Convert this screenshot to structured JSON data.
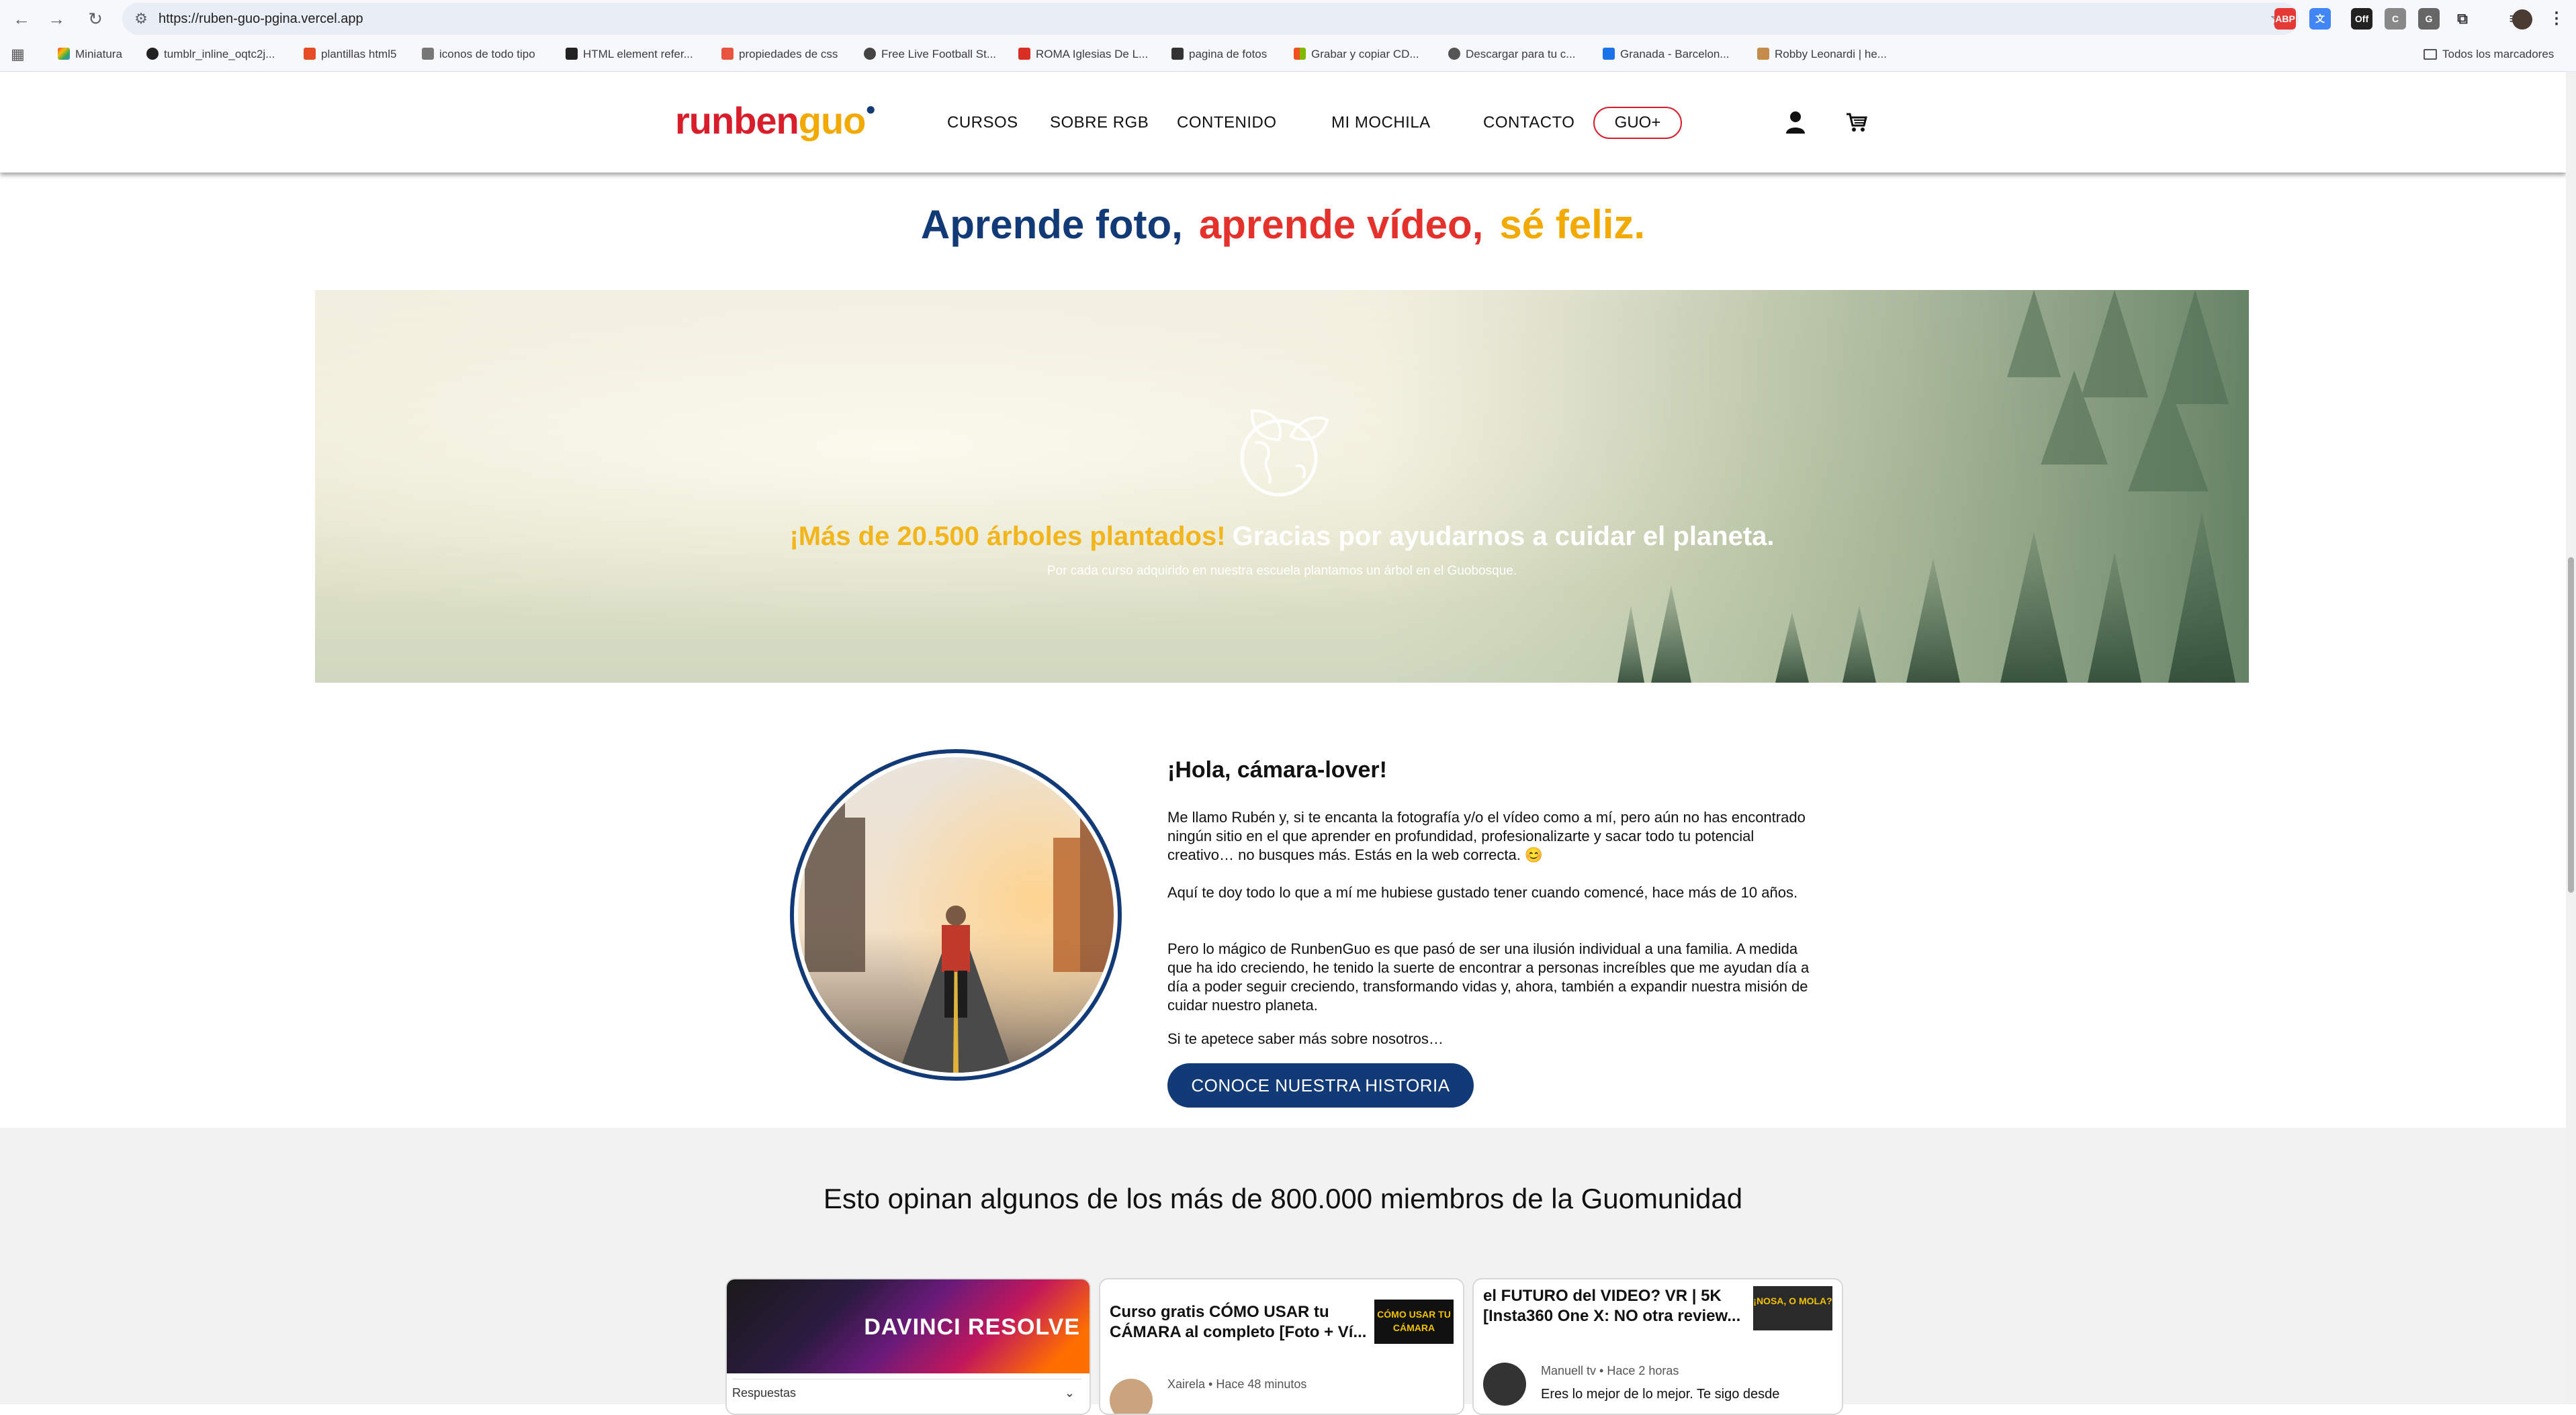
{
  "browser": {
    "url": "https://ruben-guo-pgina.vercel.app",
    "bookmarks": [
      "Miniatura",
      "tumblr_inline_oqtc2j...",
      "plantillas html5",
      "iconos de todo tipo",
      "HTML element refer...",
      "propiedades de css",
      "Free Live Football St...",
      "ROMA Iglesias De L...",
      "pagina de fotos",
      "Grabar y copiar CD...",
      "Descargar para tu c...",
      "Granada - Barcelon...",
      "Robby Leonardi | he..."
    ],
    "all_bookmarks": "Todos los marcadores"
  },
  "header": {
    "logo_part1": "runben",
    "logo_part2": "guo",
    "menu": [
      "CURSOS",
      "SOBRE RGB",
      "CONTENIDO",
      "MI MOCHILA",
      "CONTACTO"
    ],
    "guo_plus": "GUO+"
  },
  "hero": {
    "t1": "Aprende foto,",
    "t2": "aprende vídeo,",
    "t3": "sé feliz."
  },
  "banner": {
    "highlight": "¡Más de 20.500 árboles plantados!",
    "rest": "Gracias por ayudarnos a cuidar el planeta.",
    "sub": "Por cada curso adquirido en nuestra escuela plantamos un árbol en el Guobosque."
  },
  "about": {
    "title": "¡Hola, cámara-lover!",
    "p1": "Me llamo Rubén y, si te encanta la fotografía y/o el vídeo como a mí, pero aún no has encontrado ningún sitio en el que aprender en profundidad, profesionalizarte y sacar todo tu potencial creativo… no busques más. Estás en la web correcta. 😊",
    "p2": "Aquí te doy todo lo que a mí me hubiese gustado tener cuando comencé, hace más de 10 años.",
    "p3": "Pero lo mágico de RunbenGuo es que pasó de ser una ilusión individual a una familia. A medida que ha ido creciendo, he tenido la suerte de encontrar a personas increíbles que me ayudan día a día a poder seguir creciendo, transformando vidas y, ahora, también a expandir nuestra misión de cuidar nuestro planeta.",
    "p4": "Si te apetece saber más sobre nosotros…",
    "cta": "CONOCE NUESTRA HISTORIA"
  },
  "testimonials": {
    "title": "Esto opinan algunos de los más de 800.000 miembros de la Guomunidad",
    "card1": {
      "banner": "DAVINCI RESOLVE",
      "bar": "Respuestas"
    },
    "card2": {
      "title": "Curso gratis CÓMO USAR tu CÁMARA al completo [Foto + Ví...",
      "thumb": "CÓMO USAR TU CÁMARA",
      "meta": "Xairela • Hace 48 minutos"
    },
    "card3": {
      "title": "el FUTURO del VIDEO? VR | 5K [Insta360 One X: NO otra review...",
      "thumb": "¡NOSA, O MOLA?",
      "meta": "Manuell tv • Hace 2 horas",
      "snippet": "Eres lo mejor de lo mejor. Te sigo desde"
    }
  },
  "colors": {
    "brand_blue": "#123a76",
    "brand_red": "#e4312b",
    "brand_yellow": "#f2a900"
  }
}
